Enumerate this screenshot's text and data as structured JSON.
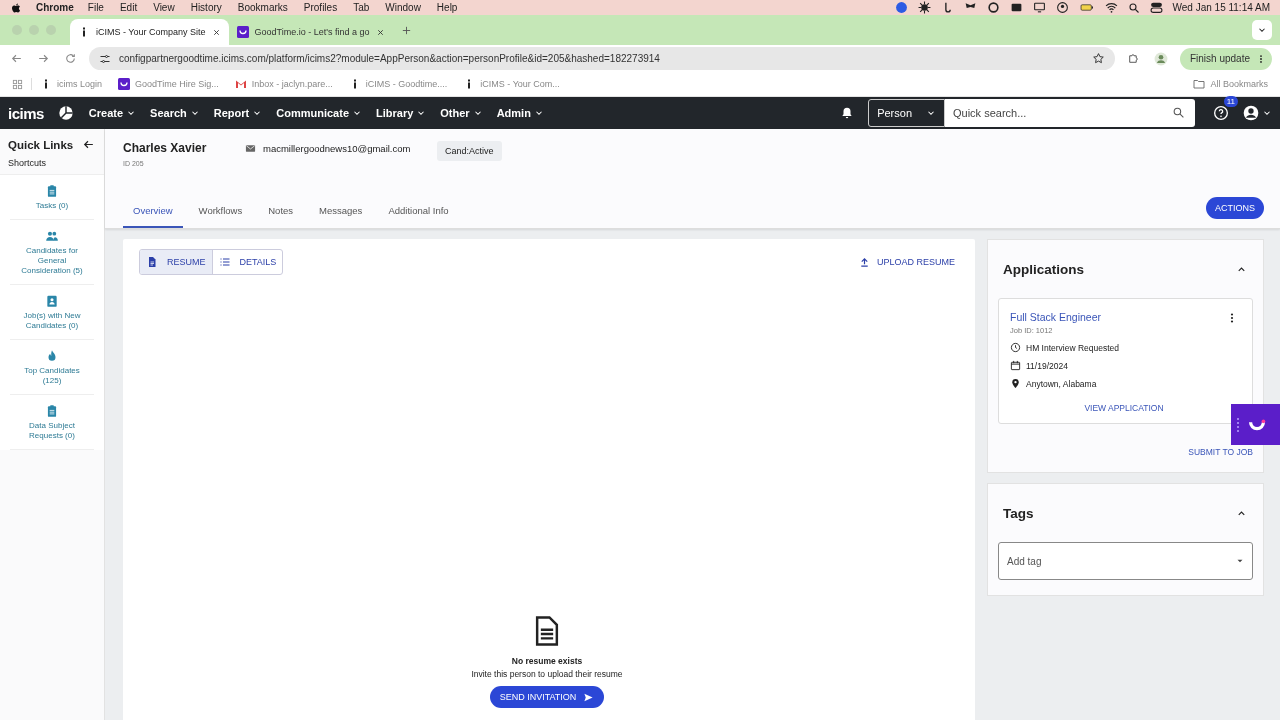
{
  "menubar": {
    "app": "Chrome",
    "menus": [
      "File",
      "Edit",
      "View",
      "History",
      "Bookmarks",
      "Profiles",
      "Tab",
      "Window",
      "Help"
    ],
    "clock": "Wed Jan 15  11:14 AM"
  },
  "browser": {
    "tabs": [
      {
        "title": "iCIMS - Your Company Site",
        "selected": true,
        "kind": "icims"
      },
      {
        "title": "GoodTime.io - Let's find a go",
        "selected": false,
        "kind": "goodtime"
      }
    ],
    "url": "configpartnergoodtime.icims.com/platform/icims2?module=AppPerson&action=personProfile&id=205&hashed=182273914",
    "update_button": "Finish update",
    "bookmarks": [
      {
        "label": "icims Login",
        "kind": "icims"
      },
      {
        "label": "GoodTime Hire Sig...",
        "kind": "goodtime"
      },
      {
        "label": "Inbox - jaclyn.pare...",
        "kind": "mail"
      },
      {
        "label": "iCIMS - Goodtime....",
        "kind": "icims"
      },
      {
        "label": "iCIMS - Your Com...",
        "kind": "icims"
      }
    ],
    "all_bookmarks": "All Bookmarks"
  },
  "app": {
    "logo": "icims",
    "nav": [
      "Create",
      "Search",
      "Report",
      "Communicate",
      "Library",
      "Other",
      "Admin"
    ],
    "search": {
      "scope": "Person",
      "placeholder": "Quick search..."
    },
    "help_badge": "11"
  },
  "sidebar": {
    "title": "Quick Links",
    "section": "Shortcuts",
    "shortcuts": [
      {
        "label": "Tasks (0)",
        "kind": "clipboard"
      },
      {
        "label": "Candidates for General Consideration (5)",
        "kind": "people"
      },
      {
        "label": "Job(s) with New Candidates (0)",
        "kind": "badge"
      },
      {
        "label": "Top Candidates (125)",
        "kind": "flame"
      },
      {
        "label": "Data Subject Requests (0)",
        "kind": "clipboard"
      }
    ]
  },
  "profile": {
    "name": "Charles Xavier",
    "id": "ID 205",
    "email": "macmillergoodnews10@gmail.com",
    "status": "Cand:Active"
  },
  "tabs": [
    {
      "label": "Overview",
      "selected": true
    },
    {
      "label": "Workflows",
      "selected": false
    },
    {
      "label": "Notes",
      "selected": false
    },
    {
      "label": "Messages",
      "selected": false
    },
    {
      "label": "Additional Info",
      "selected": false
    }
  ],
  "actions_button": "ACTIONS",
  "view_toggle": [
    {
      "label": "RESUME",
      "selected": true,
      "kind": "document"
    },
    {
      "label": "DETAILS",
      "selected": false,
      "kind": "list"
    }
  ],
  "upload_button": "UPLOAD RESUME",
  "empty_state": {
    "title": "No resume exists",
    "message": "Invite this person to upload their resume",
    "button": "SEND INVITATION"
  },
  "applications": {
    "title": "Applications",
    "expanded": true,
    "cards": [
      {
        "title": "Full Stack Engineer",
        "job_id": "Job ID: 1012",
        "status": "HM Interview Requested",
        "date": "11/19/2024",
        "location": "Anytown, Alabama",
        "link": "VIEW APPLICATION"
      }
    ],
    "submit": "SUBMIT TO JOB"
  },
  "tags": {
    "title": "Tags",
    "expanded": true,
    "placeholder": "Add tag"
  }
}
